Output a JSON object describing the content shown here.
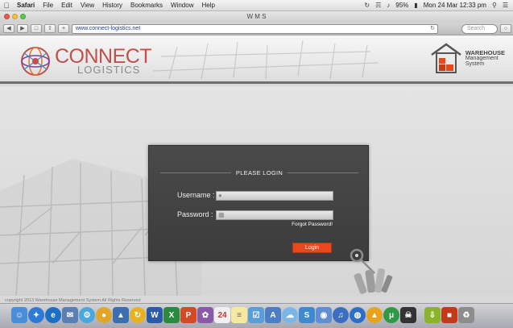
{
  "menubar": {
    "items": [
      "Safari",
      "File",
      "Edit",
      "View",
      "History",
      "Bookmarks",
      "Window",
      "Help"
    ],
    "battery": "95%",
    "clock": "Mon 24 Mar  12:33 pm"
  },
  "window": {
    "title": "W M S"
  },
  "toolbar": {
    "url": "www.connect-logistics.net",
    "search_placeholder": "Search"
  },
  "header": {
    "brand_main": "CONNECT",
    "brand_sub": "LOGISTICS",
    "wms_line1": "WAREHOUSE",
    "wms_line2": "Management",
    "wms_line3": "System"
  },
  "login": {
    "heading": "PLEASE LOGIN",
    "username_label": "Username :",
    "username_value": "",
    "password_label": "Password :",
    "forgot_label": "Forgot Password!",
    "button_label": "Login"
  },
  "footer": {
    "copyright": "copyright 2013 Warehouse Management System All Rights Reserved"
  },
  "colors": {
    "accent": "#e8481d",
    "brand_red": "#c0504d",
    "panel": "#434343"
  },
  "dock_icons": [
    "finder-icon",
    "safari-icon",
    "ie-icon",
    "chrome-icon",
    "word-icon",
    "excel-icon",
    "powerpoint-icon",
    "calendar-icon",
    "notes-icon",
    "itunes-icon",
    "app-store-icon",
    "trash-icon"
  ]
}
